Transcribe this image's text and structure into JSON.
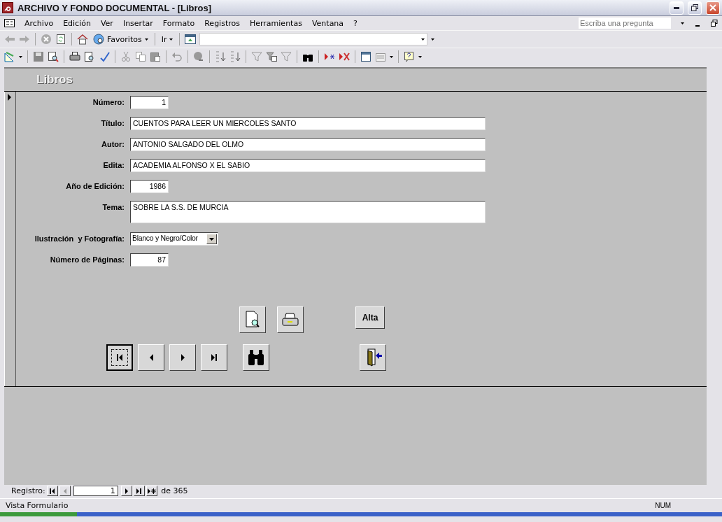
{
  "window": {
    "title": "ARCHIVO Y FONDO DOCUMENTAL - [Libros]"
  },
  "menu": [
    "Archivo",
    "Edición",
    "Ver",
    "Insertar",
    "Formato",
    "Registros",
    "Herramientas",
    "Ventana",
    "?"
  ],
  "help_box": {
    "placeholder": "Escriba una pregunta"
  },
  "web_toolbar": {
    "favorites": "Favoritos",
    "go": "Ir"
  },
  "form": {
    "title": "Libros",
    "fields": [
      {
        "label": "Número:",
        "value": "1",
        "kind": "number"
      },
      {
        "label": "Título:",
        "value": "CUENTOS PARA LEER UN MIERCOLES SANTO",
        "kind": "text"
      },
      {
        "label": "Autor:",
        "value": "ANTONIO SALGADO DEL OLMO",
        "kind": "text"
      },
      {
        "label": "Edita:",
        "value": "ACADEMIA ALFONSO X EL SABIO",
        "kind": "text"
      },
      {
        "label": "Año de Edición:",
        "value": "1986",
        "kind": "number"
      },
      {
        "label": "Tema:",
        "value": "SOBRE LA S.S. DE MURCIA",
        "kind": "memo"
      },
      {
        "label": "Ilustración  y Fotografía:",
        "value": "Blanco y Negro/Color",
        "kind": "combo"
      },
      {
        "label": "Número de Páginas:",
        "value": "87",
        "kind": "number"
      }
    ],
    "top_buttons": [
      {
        "kind": "preview"
      },
      {
        "kind": "print"
      },
      {
        "kind": "text",
        "label": "Alta"
      }
    ],
    "nav_buttons": [
      {
        "kind": "first",
        "focused": true
      },
      {
        "kind": "prev",
        "focused": false
      },
      {
        "kind": "next",
        "focused": false
      },
      {
        "kind": "last",
        "focused": false
      },
      {
        "kind": "find",
        "focused": false
      },
      {
        "kind": "exit",
        "focused": false
      }
    ]
  },
  "navigation": {
    "label": "Registro:",
    "record": "1",
    "total": "de 365"
  },
  "status_bar": {
    "view": "Vista Formulario",
    "indicator": "NUM"
  }
}
